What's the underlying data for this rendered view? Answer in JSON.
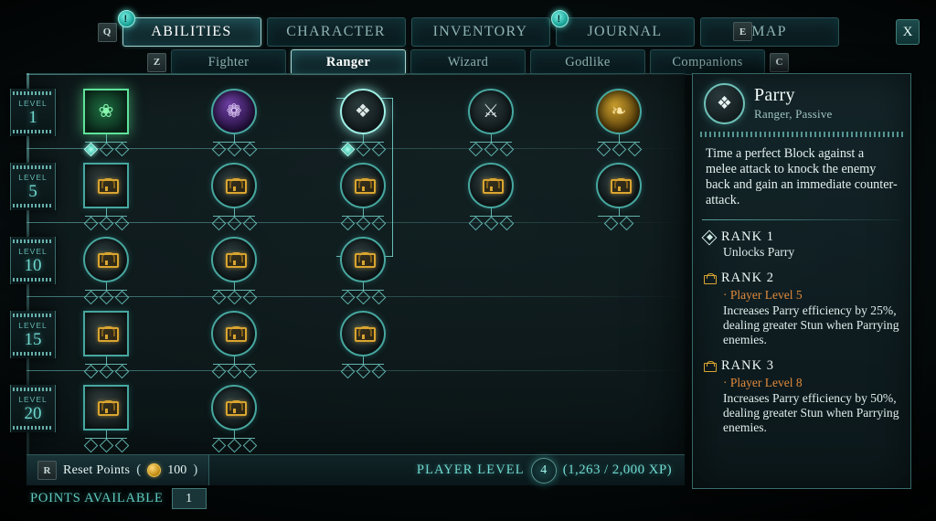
{
  "nav": {
    "hotkey_left": "Q",
    "hotkey_right": "E",
    "close_key": "X",
    "notification": "!",
    "tabs": [
      {
        "label": "ABILITIES",
        "selected": true,
        "notify": true
      },
      {
        "label": "CHARACTER",
        "selected": false,
        "notify": false
      },
      {
        "label": "INVENTORY",
        "selected": false,
        "notify": false
      },
      {
        "label": "JOURNAL",
        "selected": false,
        "notify": true
      },
      {
        "label": "MAP",
        "selected": false,
        "notify": false
      }
    ]
  },
  "classbar": {
    "hotkey_left": "Z",
    "hotkey_right": "C",
    "tabs": [
      {
        "label": "Fighter",
        "selected": false
      },
      {
        "label": "Ranger",
        "selected": true
      },
      {
        "label": "Wizard",
        "selected": false
      },
      {
        "label": "Godlike",
        "selected": false
      },
      {
        "label": "Companions",
        "selected": false
      }
    ]
  },
  "tree": {
    "level_label": "LEVEL",
    "levels": [
      "1",
      "5",
      "10",
      "15",
      "20"
    ],
    "nodes": [
      {
        "id": "n1",
        "row": 0,
        "col": 0,
        "shape": "square",
        "state": "active",
        "icon": "bow-shot-icon",
        "glyph": "❀",
        "pips": 3,
        "filled": 1
      },
      {
        "id": "n2",
        "row": 0,
        "col": 1,
        "shape": "circle",
        "state": "unlocked",
        "icon": "poison-bomb-icon",
        "glyph": "❁",
        "pips": 3,
        "filled": 0,
        "tint": "purple"
      },
      {
        "id": "n3",
        "row": 0,
        "col": 2,
        "shape": "circle",
        "state": "selected",
        "icon": "parry-icon",
        "glyph": "❖",
        "pips": 3,
        "filled": 1
      },
      {
        "id": "n4",
        "row": 0,
        "col": 3,
        "shape": "circle",
        "state": "unlocked",
        "icon": "crossed-blades-icon",
        "glyph": "⚔",
        "pips": 3,
        "filled": 0
      },
      {
        "id": "n5",
        "row": 0,
        "col": 4,
        "shape": "circle",
        "state": "unlocked",
        "icon": "gold-feather-icon",
        "glyph": "❧",
        "pips": 3,
        "filled": 0,
        "tint": "gold"
      },
      {
        "id": "n6",
        "row": 1,
        "col": 0,
        "shape": "square",
        "state": "locked",
        "icon": "lock-icon",
        "pips": 3,
        "filled": 0
      },
      {
        "id": "n7",
        "row": 1,
        "col": 1,
        "shape": "circle",
        "state": "locked",
        "icon": "lock-icon",
        "pips": 3,
        "filled": 0
      },
      {
        "id": "n8",
        "row": 1,
        "col": 2,
        "shape": "circle",
        "state": "locked",
        "icon": "lock-icon",
        "pips": 3,
        "filled": 0
      },
      {
        "id": "n9",
        "row": 1,
        "col": 3,
        "shape": "circle",
        "state": "locked",
        "icon": "lock-icon",
        "pips": 3,
        "filled": 0
      },
      {
        "id": "n10",
        "row": 1,
        "col": 4,
        "shape": "circle",
        "state": "locked",
        "icon": "lock-icon",
        "pips": 2,
        "filled": 0
      },
      {
        "id": "n11",
        "row": 2,
        "col": 0,
        "shape": "circle",
        "state": "locked",
        "icon": "lock-icon",
        "pips": 3,
        "filled": 0
      },
      {
        "id": "n12",
        "row": 2,
        "col": 1,
        "shape": "circle",
        "state": "locked",
        "icon": "lock-icon",
        "pips": 3,
        "filled": 0
      },
      {
        "id": "n13",
        "row": 2,
        "col": 2,
        "shape": "circle",
        "state": "locked",
        "icon": "lock-icon",
        "pips": 3,
        "filled": 0
      },
      {
        "id": "n14",
        "row": 3,
        "col": 0,
        "shape": "square",
        "state": "locked",
        "icon": "lock-icon",
        "pips": 3,
        "filled": 0
      },
      {
        "id": "n15",
        "row": 3,
        "col": 1,
        "shape": "circle",
        "state": "locked",
        "icon": "lock-icon",
        "pips": 3,
        "filled": 0
      },
      {
        "id": "n16",
        "row": 3,
        "col": 2,
        "shape": "circle",
        "state": "locked",
        "icon": "lock-icon",
        "pips": 3,
        "filled": 0
      },
      {
        "id": "n17",
        "row": 4,
        "col": 0,
        "shape": "square",
        "state": "locked",
        "icon": "lock-icon",
        "pips": 3,
        "filled": 0
      },
      {
        "id": "n18",
        "row": 4,
        "col": 1,
        "shape": "circle",
        "state": "locked",
        "icon": "lock-icon",
        "pips": 3,
        "filled": 0
      }
    ]
  },
  "info": {
    "icon": "parry-icon",
    "title": "Parry",
    "subtitle": "Ranger, Passive",
    "description": "Time a perfect Block against a melee attack to knock the enemy back and gain an immediate counter-attack.",
    "ranks": [
      {
        "name": "RANK 1",
        "state": "unlocked",
        "requirement": "",
        "body": "Unlocks Parry"
      },
      {
        "name": "RANK 2",
        "state": "locked",
        "requirement": "· Player Level 5",
        "body": "Increases Parry efficiency by 25%, dealing greater Stun when Parrying enemies."
      },
      {
        "name": "RANK 3",
        "state": "locked",
        "requirement": "· Player Level 8",
        "body": "Increases Parry efficiency by 50%, dealing greater Stun when Parrying enemies."
      }
    ]
  },
  "footer": {
    "reset_key": "R",
    "reset_label": "Reset Points",
    "reset_cost": "100",
    "paren_open": "(",
    "paren_close": ")",
    "player_level_label": "PLAYER LEVEL",
    "player_level": "4",
    "xp": "(1,263 / 2,000 XP)",
    "points_available_label": "POINTS AVAILABLE",
    "points_available": "1"
  },
  "colors": {
    "accent": "#6fd9d0",
    "locked": "#d9a531",
    "requirement": "#e08a3c",
    "active": "#5fe39a"
  }
}
